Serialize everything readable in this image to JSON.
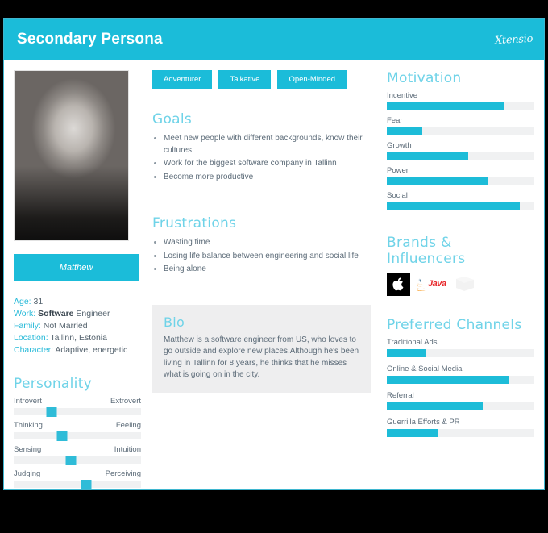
{
  "header": {
    "title": "Secondary Persona",
    "logo": "Xtensio"
  },
  "profile": {
    "name": "Matthew",
    "photo_alt": "portrait-photo",
    "details": [
      {
        "label": "Age:",
        "value": "31",
        "bold_prefix": ""
      },
      {
        "label": "Work:",
        "value": " Engineer",
        "bold_prefix": "Software"
      },
      {
        "label": "Family:",
        "value": "Not Married",
        "bold_prefix": ""
      },
      {
        "label": "Location:",
        "value": "Tallinn, Estonia",
        "bold_prefix": ""
      },
      {
        "label": "Character:",
        "value": "Adaptive, energetic",
        "bold_prefix": ""
      }
    ]
  },
  "personality": {
    "title": "Personality",
    "sliders": [
      {
        "left": "Introvert",
        "right": "Extrovert",
        "value": 30
      },
      {
        "left": "Thinking",
        "right": "Feeling",
        "value": 38
      },
      {
        "left": "Sensing",
        "right": "Intuition",
        "value": 45
      },
      {
        "left": "Judging",
        "right": "Perceiving",
        "value": 57
      }
    ]
  },
  "tags": [
    "Adventurer",
    "Talkative",
    "Open-Minded"
  ],
  "goals": {
    "title": "Goals",
    "items": [
      "Meet new people with different backgrounds, know their cultures",
      "Work for the biggest software company in Tallinn",
      "Become more productive"
    ]
  },
  "frustrations": {
    "title": "Frustrations",
    "items": [
      "Wasting time",
      "Losing life balance between engineering and social life",
      "Being alone"
    ]
  },
  "bio": {
    "title": "Bio",
    "text": "Matthew is a software engineer from US, who loves to go outside and explore new places.Although he's been living in Tallinn for 8 years, he thinks that he misses what is going on in the city."
  },
  "motivation": {
    "title": "Motivation",
    "bars": [
      {
        "label": "Incentive",
        "value": 79
      },
      {
        "label": "Fear",
        "value": 24
      },
      {
        "label": "Growth",
        "value": 55
      },
      {
        "label": "Power",
        "value": 69
      },
      {
        "label": "Social",
        "value": 90
      }
    ]
  },
  "brands": {
    "title": "Brands & Influencers",
    "items": [
      {
        "name": "apple-logo",
        "label": ""
      },
      {
        "name": "java-logo",
        "label": "Java"
      },
      {
        "name": "unknown-logo",
        "label": "logo"
      }
    ]
  },
  "channels": {
    "title": "Preferred Channels",
    "bars": [
      {
        "label": "Traditional Ads",
        "value": 27
      },
      {
        "label": "Online & Social Media",
        "value": 83
      },
      {
        "label": "Referral",
        "value": 65
      },
      {
        "label": "Guerrilla Efforts & PR",
        "value": 35
      }
    ]
  },
  "colors": {
    "accent": "#1bbcd9",
    "heading": "#6fd3e8",
    "text": "#5d6c79",
    "track": "#f0f1f2",
    "bio_bg": "#eeeeef"
  }
}
